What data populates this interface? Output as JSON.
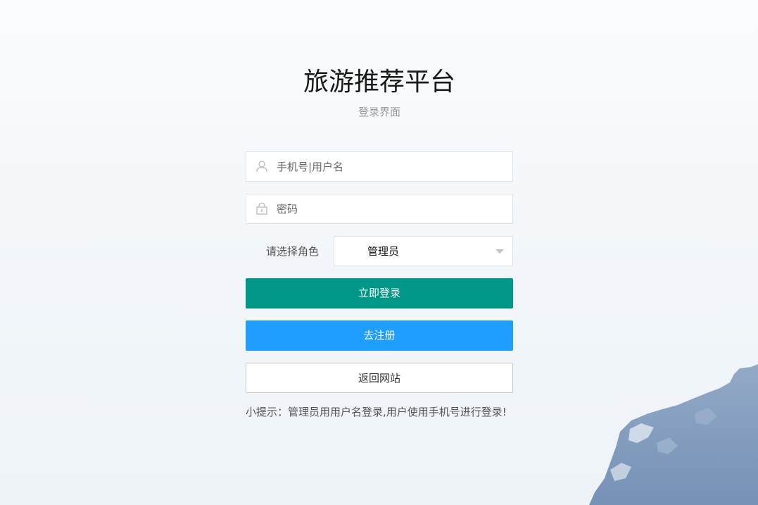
{
  "page": {
    "title": "旅游推荐平台",
    "subtitle": "登录界面"
  },
  "form": {
    "username": {
      "placeholder": "手机号|用户名",
      "value": "",
      "icon": "user-icon"
    },
    "password": {
      "placeholder": "密码",
      "value": "",
      "icon": "lock-icon"
    },
    "role": {
      "label": "请选择角色",
      "selected": "管理员"
    },
    "buttons": {
      "login": "立即登录",
      "register": "去注册",
      "back": "返回网站"
    },
    "tip": "小提示：管理员用用户名登录,用户使用手机号进行登录!"
  },
  "colors": {
    "login_button": "#009688",
    "register_button": "#1e9fff",
    "background": "#f3f7fa"
  }
}
